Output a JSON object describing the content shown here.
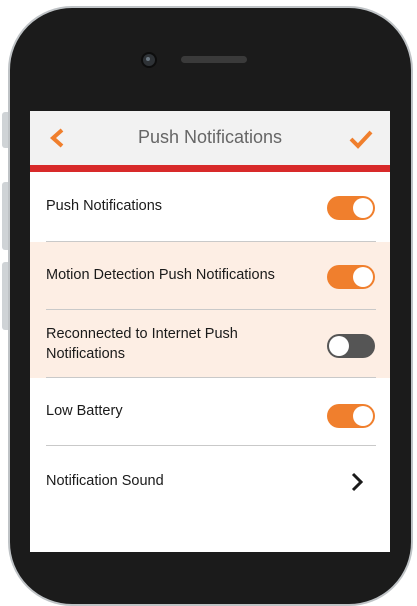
{
  "header": {
    "title": "Push Notifications",
    "back_icon": "chevron-left-icon",
    "confirm_icon": "checkmark-icon"
  },
  "rows": [
    {
      "label": "Push Notifications",
      "toggle": "on",
      "highlighted": false
    },
    {
      "label": "Motion Detection Push Notifications",
      "toggle": "on",
      "highlighted": true
    },
    {
      "label_line1": "Reconnected to Internet Push",
      "label_line2": "Notifications",
      "toggle": "off",
      "highlighted": true
    },
    {
      "label": "Low Battery",
      "toggle": "on",
      "highlighted": false
    },
    {
      "label": "Notification Sound",
      "icon": "chevron-right-icon",
      "highlighted": false
    }
  ],
  "colors": {
    "accent": "#f07f2d",
    "header_bar": "#d82a2a",
    "highlight_bg": "#fdeee4",
    "toggle_off": "#555555"
  }
}
